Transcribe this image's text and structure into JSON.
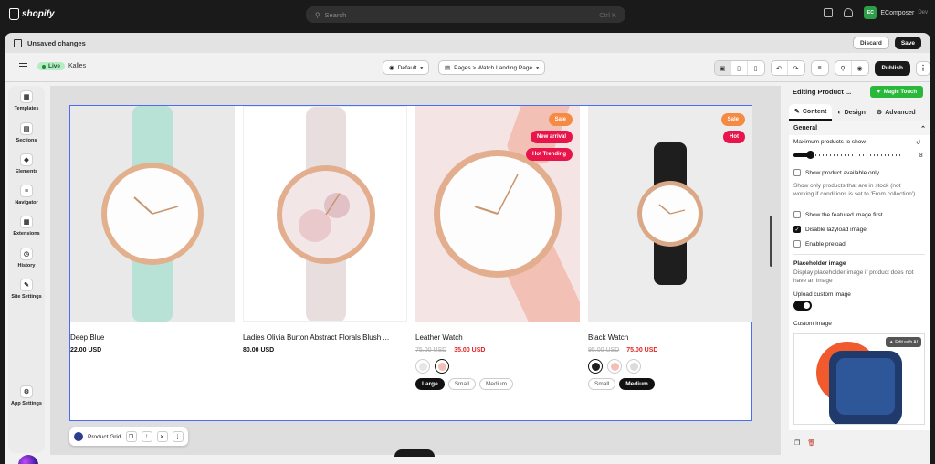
{
  "topbar": {
    "logo": "shopify",
    "search_placeholder": "Search",
    "search_shortcut": "Ctrl K",
    "store_name": "EComposer",
    "store_sub": "Dev",
    "store_initials": "EC"
  },
  "unsaved": {
    "label": "Unsaved changes",
    "discard": "Discard",
    "save": "Save"
  },
  "toolbar": {
    "live": "Live",
    "theme": "Kalles",
    "default_select": "Default",
    "page_select": "Pages > Watch Landing Page",
    "publish": "Publish"
  },
  "sidebar": {
    "items": [
      {
        "label": "Templates",
        "icon": "templates-icon"
      },
      {
        "label": "Sections",
        "icon": "sections-icon"
      },
      {
        "label": "Elements",
        "icon": "elements-icon"
      },
      {
        "label": "Navigator",
        "icon": "navigator-icon"
      },
      {
        "label": "Extensions",
        "icon": "extensions-icon"
      },
      {
        "label": "History",
        "icon": "history-icon"
      },
      {
        "label": "Site Settings",
        "icon": "site-settings-icon"
      },
      {
        "label": "App Settings",
        "icon": "app-settings-icon"
      }
    ]
  },
  "products": [
    {
      "name": "Deep Blue",
      "price": "22.00 USD",
      "old_price": "",
      "strap": "#b8e2d6"
    },
    {
      "name": "Ladies Olivia Burton Abstract Florals Blush ...",
      "price": "80.00 USD",
      "old_price": "",
      "strap": "#e8dedd"
    },
    {
      "name": "Leather Watch",
      "price": "35.00 USD",
      "old_price": "75.00 USD",
      "strap": "#f2c0b5",
      "badges": [
        "Sale",
        "New arrival",
        "Hot Trending"
      ],
      "sizes": [
        "Large",
        "Small",
        "Medium"
      ],
      "active_size": "Large"
    },
    {
      "name": "Black Watch",
      "price": "75.00 USD",
      "old_price": "95.00 USD",
      "strap": "#1e1e1e",
      "badges": [
        "Sale",
        "Hot"
      ],
      "sizes": [
        "Small",
        "Medium"
      ],
      "active_size": "Medium"
    }
  ],
  "element_bar": {
    "label": "Product Grid"
  },
  "panel": {
    "title": "Editing Product ...",
    "magic": "Magic Touch",
    "tabs": [
      "Content",
      "Design",
      "Advanced"
    ],
    "section": "General",
    "max_products_label": "Maximum products to show",
    "max_products_value": "8",
    "max_products_fraction": 0.15,
    "show_available": "Show product available only",
    "show_available_help": "Show only products that are in stock (not working if conditions is set to 'From collection')",
    "show_featured": "Show the featured image first",
    "disable_lazy": "Disable lazyload image",
    "enable_preload": "Enable preload",
    "placeholder_title": "Placeholder image",
    "placeholder_help": "Display placeholder image if product does not have an image",
    "upload_custom": "Upload custom image",
    "custom_image": "Custom image",
    "edit_ai": "Edit with AI"
  },
  "colors": {
    "accent_green": "#29b83a",
    "sale_orange": "#f58a42",
    "badge_red": "#e8154b",
    "price_red": "#e02424"
  }
}
